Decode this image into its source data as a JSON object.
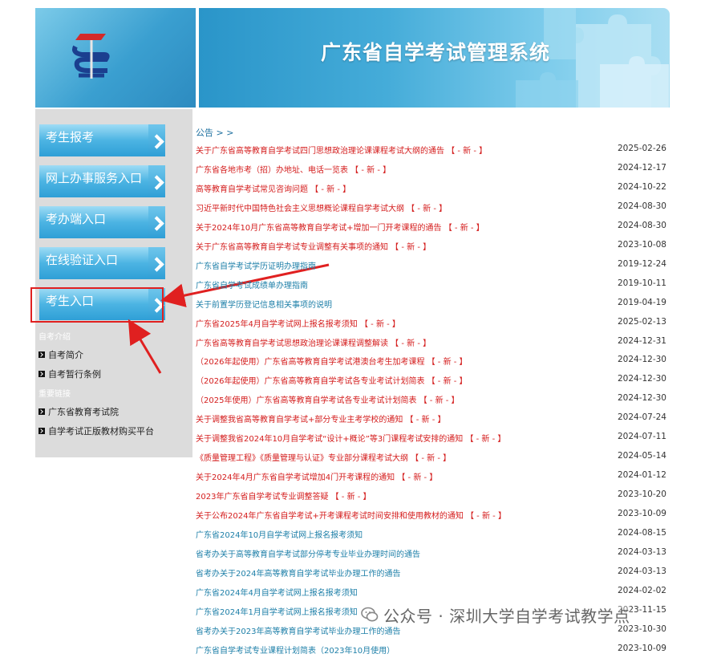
{
  "header": {
    "title": "广东省自学考试管理系统"
  },
  "sidebar": {
    "menu": [
      {
        "label": "考生报考"
      },
      {
        "label": "网上办事服务入口"
      },
      {
        "label": "考办端入口"
      },
      {
        "label": "在线验证入口"
      },
      {
        "label": "考生入口"
      }
    ],
    "intro_head": "自考介绍",
    "intro_links": [
      {
        "label": "自考简介"
      },
      {
        "label": "自考暂行条例"
      }
    ],
    "links_head": "重要链接",
    "important_links": [
      {
        "label": "广东省教育考试院"
      },
      {
        "label": "自学考试正版教材购买平台"
      }
    ]
  },
  "notices": {
    "head": "公告 > >",
    "items": [
      {
        "title": "关于广东省高等教育自学考试四门思想政治理论课课程考试大纲的通告 【 - 新 - 】",
        "date": "2025-02-26",
        "color": "red"
      },
      {
        "title": "广东省各地市考（招）办地址、电话一览表 【 - 新 - 】",
        "date": "2024-12-17",
        "color": "red"
      },
      {
        "title": "高等教育自学考试常见咨询问题 【 - 新 - 】",
        "date": "2024-10-22",
        "color": "red"
      },
      {
        "title": "习近平新时代中国特色社会主义思想概论课程自学考试大纲 【 - 新 - 】",
        "date": "2024-08-30",
        "color": "red"
      },
      {
        "title": "关于2024年10月广东省高等教育自学考试+增加一门开考课程的通告 【 - 新 - 】",
        "date": "2024-08-30",
        "color": "red"
      },
      {
        "title": "关于广东省高等教育自学考试专业调整有关事项的通知 【 - 新 - 】",
        "date": "2023-10-08",
        "color": "red"
      },
      {
        "title": "广东省自学考试学历证明办理指南",
        "date": "2019-12-24",
        "color": "teal"
      },
      {
        "title": "广东省自学考试成绩单办理指南",
        "date": "2019-10-11",
        "color": "teal"
      },
      {
        "title": "关于前置学历登记信息相关事项的说明",
        "date": "2019-04-19",
        "color": "teal"
      },
      {
        "title": "广东省2025年4月自学考试网上报名报考须知 【 - 新 - 】",
        "date": "2025-02-13",
        "color": "red"
      },
      {
        "title": "广东省高等教育自学考试思想政治理论课课程调整解读 【 - 新 - 】",
        "date": "2024-12-31",
        "color": "red"
      },
      {
        "title": "（2026年起使用）广东省高等教育自学考试港澳台考生加考课程 【 - 新 - 】",
        "date": "2024-12-30",
        "color": "red"
      },
      {
        "title": "（2026年起使用）广东省高等教育自学考试各专业考试计划简表 【 - 新 - 】",
        "date": "2024-12-30",
        "color": "red"
      },
      {
        "title": "（2025年使用）广东省高等教育自学考试各专业考试计划简表 【 - 新 - 】",
        "date": "2024-12-30",
        "color": "red"
      },
      {
        "title": "关于调整我省高等教育自学考试+部分专业主考学校的通知 【 - 新 - 】",
        "date": "2024-07-24",
        "color": "red"
      },
      {
        "title": "关于调整我省2024年10月自学考试“设计+概论”等3门课程考试安排的通知 【 - 新 - 】",
        "date": "2024-07-11",
        "color": "red"
      },
      {
        "title": "《质量管理工程》《质量管理与认证》专业部分课程考试大纲 【 - 新 - 】",
        "date": "2024-05-14",
        "color": "red"
      },
      {
        "title": "关于2024年4月广东省自学考试增加4门开考课程的通知 【 - 新 - 】",
        "date": "2024-01-12",
        "color": "red"
      },
      {
        "title": "2023年广东省自学考试专业调整答疑 【 - 新 - 】",
        "date": "2023-10-20",
        "color": "red"
      },
      {
        "title": "关于公布2024年广东省自学考试+开考课程考试时间安排和使用教材的通知 【 - 新 - 】",
        "date": "2023-10-09",
        "color": "red"
      },
      {
        "title": "广东省2024年10月自学考试网上报名报考须知",
        "date": "2024-08-15",
        "color": "teal"
      },
      {
        "title": "省考办关于高等教育自学考试部分停考专业毕业办理时间的通告",
        "date": "2024-03-13",
        "color": "teal"
      },
      {
        "title": "省考办关于2024年高等教育自学考试毕业办理工作的通告",
        "date": "2024-03-13",
        "color": "teal"
      },
      {
        "title": "广东省2024年4月自学考试网上报名报考须知",
        "date": "2024-02-02",
        "color": "teal"
      },
      {
        "title": "广东省2024年1月自学考试网上报名报考须知",
        "date": "2023-11-15",
        "color": "teal"
      },
      {
        "title": "省考办关于2023年高等教育自学考试毕业办理工作的通告",
        "date": "2023-10-30",
        "color": "teal"
      },
      {
        "title": "广东省自学考试专业课程计划简表（2023年10月使用）",
        "date": "2023-10-09",
        "color": "teal"
      }
    ]
  },
  "watermark": {
    "text": "公众号 · 深圳大学自学考试教学点"
  },
  "colors": {
    "accent_blue": "#3aa7dc",
    "notice_red": "#d41c1c",
    "notice_teal": "#1d7fa8",
    "annotation_red": "#e02020"
  }
}
